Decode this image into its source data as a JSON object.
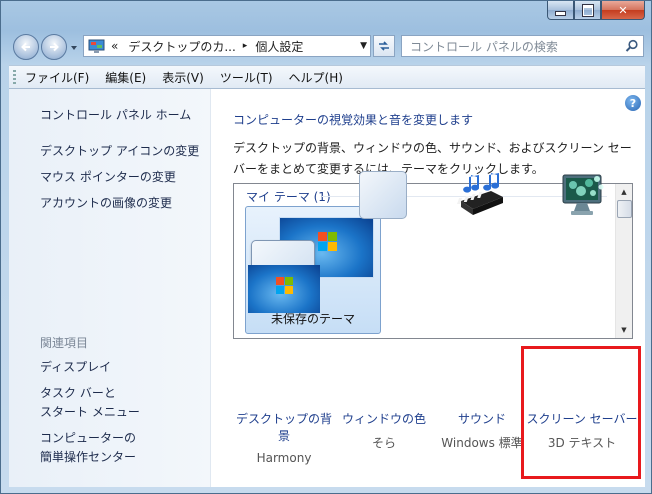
{
  "window": {
    "caption_buttons": [
      "minimize",
      "maximize",
      "close"
    ]
  },
  "nav": {
    "back_icon": "back-arrow-icon",
    "forward_icon": "forward-arrow-icon"
  },
  "address": {
    "overflow": "«",
    "crumb1": "デスクトップのカ...",
    "sep": "▸",
    "crumb2": "個人設定"
  },
  "search": {
    "placeholder": "コントロール パネルの検索"
  },
  "menu": {
    "items": [
      "ファイル(F)",
      "編集(E)",
      "表示(V)",
      "ツール(T)",
      "ヘルプ(H)"
    ]
  },
  "sidebar": {
    "home": "コントロール パネル ホーム",
    "links": [
      "デスクトップ アイコンの変更",
      "マウス ポインターの変更",
      "アカウントの画像の変更"
    ],
    "related_header": "関連項目",
    "related": [
      "ディスプレイ",
      "タスク バーと",
      "スタート メニュー",
      "コンピューターの",
      "簡単操作センター"
    ]
  },
  "main": {
    "help_glyph": "?",
    "heading": "コンピューターの視覚効果と音を変更します",
    "description": "デスクトップの背景、ウィンドウの色、サウンド、およびスクリーン セーバーをまとめて変更するには、テーマをクリックします。",
    "theme_group": "マイ テーマ (1)",
    "theme_label": "未保存のテーマ"
  },
  "options": [
    {
      "name": "デスクトップの背景",
      "sub": "Harmony"
    },
    {
      "name": "ウィンドウの色",
      "sub": "そら"
    },
    {
      "name": "サウンド",
      "sub": "Windows 標準"
    },
    {
      "name": "スクリーン セーバー",
      "sub": "3D テキスト"
    }
  ],
  "colors": {
    "link": "#1f3f8d",
    "highlight": "#e8191d"
  }
}
